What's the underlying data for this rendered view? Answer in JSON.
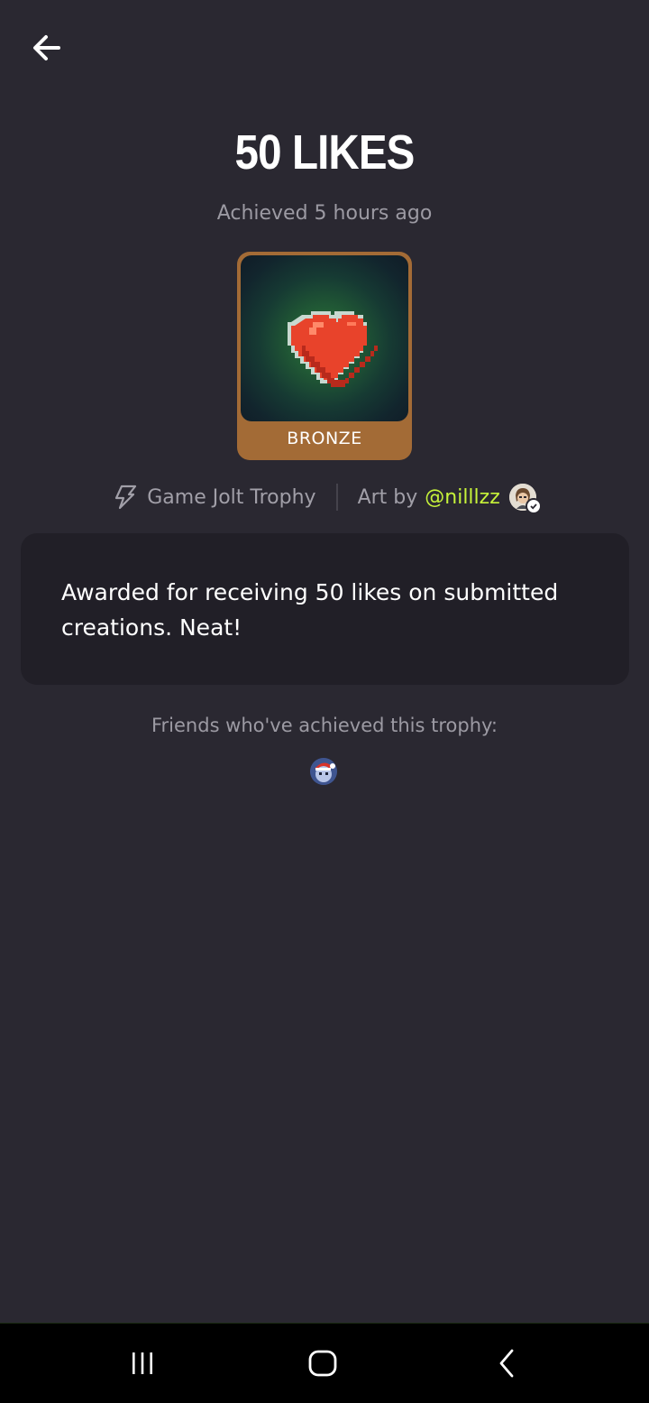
{
  "header": {
    "back_icon": "arrow-left-icon"
  },
  "trophy": {
    "title": "50 LIKES",
    "achieved": "Achieved 5 hours ago",
    "tier": "BRONZE",
    "tier_color": "#a36b36",
    "image_icon": "pixel-heart-icon",
    "source_icon": "game-jolt-icon",
    "source": "Game Jolt Trophy",
    "art_by_label": "Art by",
    "artist": "@nilllzz",
    "artist_color": "#c7f33a",
    "description": "Awarded for receiving 50 likes on submitted creations. Neat!"
  },
  "friends": {
    "label": "Friends who've achieved this trophy:"
  },
  "system_nav": {
    "recents_icon": "recents-icon",
    "home_icon": "home-icon",
    "back_icon": "back-chevron-icon"
  },
  "colors": {
    "background": "#2a2831",
    "card": "#211f27",
    "muted_text": "#9c9aa3"
  }
}
